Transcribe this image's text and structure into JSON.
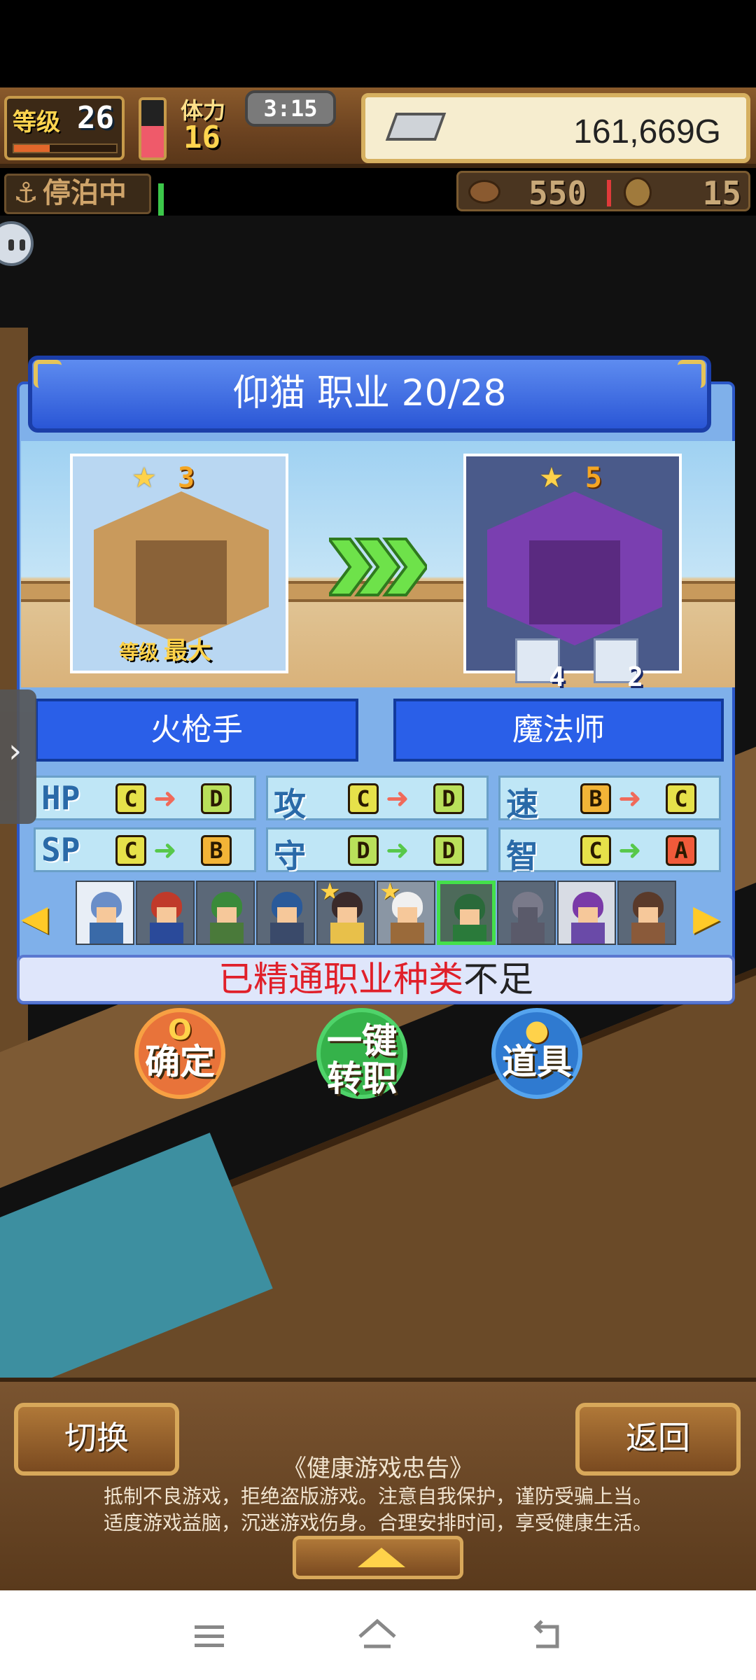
{
  "hud": {
    "level_label": "等级",
    "level_value": "26",
    "level_exp_fraction": 0.35,
    "stamina_label": "体力",
    "stamina_value": "16",
    "stamina_fraction": 0.55,
    "timer": "3:15",
    "gold": "161,669G",
    "dock_status": "停泊中",
    "resource_a": "550",
    "resource_b": "15"
  },
  "panel": {
    "title": "仰猫  职业 20/28",
    "from_rank": "3",
    "to_rank": "5",
    "from_level_label": "等级",
    "from_level_value": "最大",
    "item1_count": "4",
    "item2_count": "2",
    "from_job": "火枪手",
    "to_job": "魔法师",
    "stats": [
      {
        "name": "HP",
        "from": "C",
        "to": "D",
        "trend": "down"
      },
      {
        "name": "攻",
        "from": "C",
        "to": "D",
        "trend": "down"
      },
      {
        "name": "速",
        "from": "B",
        "to": "C",
        "trend": "down"
      },
      {
        "name": "SP",
        "from": "C",
        "to": "B",
        "trend": "up"
      },
      {
        "name": "守",
        "from": "D",
        "to": "D",
        "trend": "up"
      },
      {
        "name": "智",
        "from": "C",
        "to": "A",
        "trend": "up"
      }
    ],
    "message_red": "已精通职业种类",
    "message_dark": "不足"
  },
  "actions": {
    "confirm_icon": "O",
    "confirm_label": "确定",
    "oneclick_label_1": "一键",
    "oneclick_label_2": "转职",
    "items_label": "道具"
  },
  "bottom": {
    "switch_label": "切换",
    "back_label": "返回",
    "health_title": "《健康游戏忠告》",
    "health_line1": "抵制不良游戏，拒绝盗版游戏。注意自我保护，谨防受骗上当。",
    "health_line2": "适度游戏益脑，沉迷游戏伤身。合理安排时间，享受健康生活。"
  },
  "colors": {
    "grade_up": "#57c84a",
    "grade_down": "#f06a5a",
    "grade_C": "#e6e14a",
    "grade_D": "#b9e05a",
    "grade_B": "#f2b437",
    "grade_A": "#f05a3a"
  },
  "icons": {
    "menu": "menu-icon",
    "home": "home-icon",
    "back": "back-icon"
  }
}
